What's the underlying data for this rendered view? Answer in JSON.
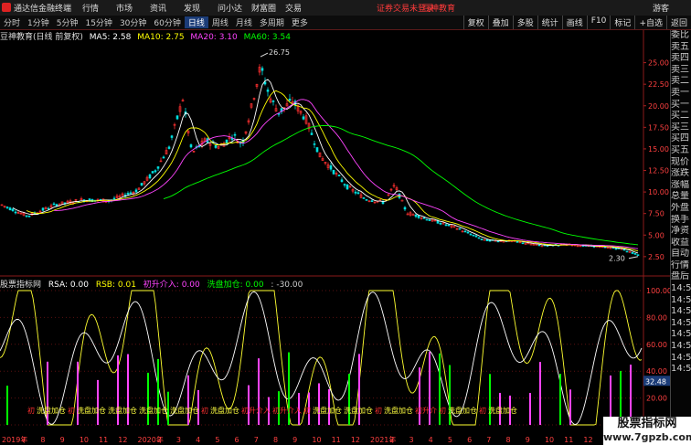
{
  "menubar": {
    "app_title": "通达信金融终端",
    "menus": [
      "行情",
      "市场",
      "资讯",
      "发现",
      "问小达",
      "财富圈",
      "交易"
    ],
    "notice": "证券交易未登录",
    "brand": "豆神教育",
    "guest": "游客"
  },
  "toolbar": {
    "periods": [
      "分时",
      "1分钟",
      "5分钟",
      "15分钟",
      "30分钟",
      "60分钟",
      "日线",
      "周线",
      "月线",
      "多周期",
      "更多"
    ],
    "active_period": "日线",
    "right_buttons": [
      "复权",
      "叠加",
      "多股",
      "统计",
      "画线",
      "F10",
      "标记",
      "+自选",
      "返回"
    ]
  },
  "info": {
    "title": "豆神教育(日线 前复权)",
    "ma5": "MA5: 2.58",
    "ma10": "MA10: 2.75",
    "ma20": "MA20: 3.10",
    "ma60": "MA60: 3.54",
    "colors": {
      "ma5": "#ffffff",
      "ma10": "#ffff00",
      "ma20": "#ff44ff",
      "ma60": "#00ff00"
    }
  },
  "price_axis": {
    "ticks": [
      "25.00",
      "22.50",
      "20.00",
      "17.50",
      "15.00",
      "12.50",
      "10.00",
      "7.50",
      "5.00",
      "2.50"
    ]
  },
  "price_axis_values": [
    25.0,
    22.5,
    20.0,
    17.5,
    15.0,
    12.5,
    10.0,
    7.5,
    5.0,
    2.5
  ],
  "annotations": {
    "high": "26.75",
    "low": "2.30"
  },
  "indicator": {
    "name": "股票指标网",
    "rsa": "RSA: 0.00",
    "rsb": "RSB: 0.01",
    "entry": "初升介入: 0.00",
    "wash": "洗盘加仓: 0.00",
    "extra": ": -30.00",
    "axis": [
      "100.00",
      "80.00",
      "60.00",
      "40.00",
      "20.00",
      "0.00"
    ],
    "current": "32.48"
  },
  "bottom_labels": [
    {
      "text": "初",
      "color": "#ff3030"
    },
    {
      "text": "洗盘加仓",
      "color": "#ffff40"
    },
    {
      "text": "初",
      "color": "#ff3030"
    },
    {
      "text": "洗盘加仓",
      "color": "#ffff40"
    },
    {
      "text": "洗盘加仓",
      "color": "#ffff40"
    },
    {
      "text": "洗盘加仓",
      "color": "#ffff40"
    },
    {
      "text": "洗盘加仓",
      "color": "#ffff40"
    },
    {
      "text": "初",
      "color": "#ff3030"
    },
    {
      "text": "洗盘加仓",
      "color": "#ffff40"
    },
    {
      "text": "初升介入",
      "color": "#ff3030"
    },
    {
      "text": "初升介入",
      "color": "#ff3030"
    },
    {
      "text": "初",
      "color": "#ff3030"
    },
    {
      "text": "洗盘加仓",
      "color": "#ffff40"
    },
    {
      "text": "洗盘加仓",
      "color": "#ffff40"
    },
    {
      "text": "初",
      "color": "#ff3030"
    },
    {
      "text": "洗盘加仓",
      "color": "#ffff40"
    },
    {
      "text": "初升介",
      "color": "#ff3030"
    },
    {
      "text": "初",
      "color": "#ff3030"
    },
    {
      "text": "洗盘加仓",
      "color": "#ffff40"
    },
    {
      "text": "初",
      "color": "#ff3030"
    },
    {
      "text": "洗盘加仓",
      "color": "#ffff40"
    }
  ],
  "date_axis": [
    "2019年",
    "7",
    "8",
    "9",
    "10",
    "11",
    "12",
    "2020年",
    "2",
    "3",
    "4",
    "5",
    "6",
    "7",
    "8",
    "9",
    "10",
    "11",
    "12",
    "2021年",
    "2",
    "3",
    "4",
    "5",
    "6",
    "7",
    "8",
    "9",
    "10",
    "11",
    "12",
    "1",
    "2"
  ],
  "sidebar": [
    "委比",
    "卖五",
    "卖四",
    "卖三",
    "卖二",
    "卖一",
    "买一",
    "买二",
    "买三",
    "买四",
    "买五",
    "现价",
    "涨跌",
    "涨幅",
    "总量",
    "外盘",
    "换手",
    "净资",
    "收益",
    "自动",
    "行情",
    "盘后",
    "14:56",
    "14:56",
    "14:56",
    "14:56",
    "14:56",
    "14:56",
    "14:56",
    "14:56"
  ],
  "watermark": {
    "line1": "股票指标网",
    "line2": "www.7gpzb.com"
  }
}
